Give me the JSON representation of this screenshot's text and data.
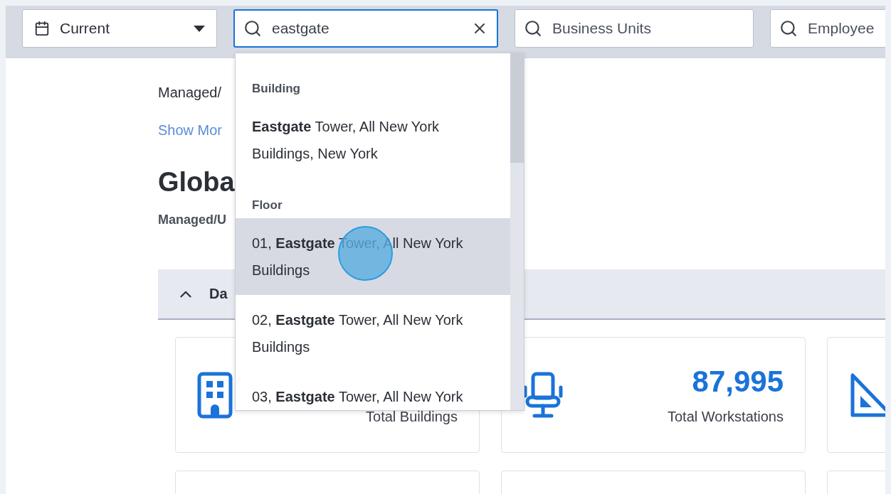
{
  "top_bar": {
    "date_select": {
      "value": "Current"
    },
    "search": {
      "value": "eastgate",
      "focused": true
    },
    "filters": [
      {
        "placeholder": "Business Units"
      },
      {
        "placeholder": "Employee"
      }
    ]
  },
  "page": {
    "breadcrumb": "Managed/",
    "show_more_link": "Show Mor",
    "title": "Globa",
    "subtitle": "Managed/U",
    "section": {
      "title": "Da",
      "expanded": true
    },
    "cards": [
      {
        "kind": "building",
        "label": "Total Buildings"
      },
      {
        "kind": "workstation",
        "value": "87,995",
        "label": "Total Workstations"
      },
      {
        "kind": "area"
      },
      {
        "kind": "empty"
      },
      {
        "kind": "empty"
      },
      {
        "kind": "empty"
      }
    ]
  },
  "dropdown": {
    "groups": [
      {
        "label": "Building",
        "items": [
          {
            "text": "**Eastgate** Tower, All New York Buildings, New York",
            "selected": false
          }
        ]
      },
      {
        "label": "Floor",
        "items": [
          {
            "text": "01, **Eastgate** Tower, All New York Buildings",
            "selected": true
          },
          {
            "text": "02, **Eastgate** Tower, All New York Buildings",
            "selected": false
          },
          {
            "text": "03, **Eastgate** Tower, All New York",
            "selected": false
          }
        ]
      }
    ]
  }
}
